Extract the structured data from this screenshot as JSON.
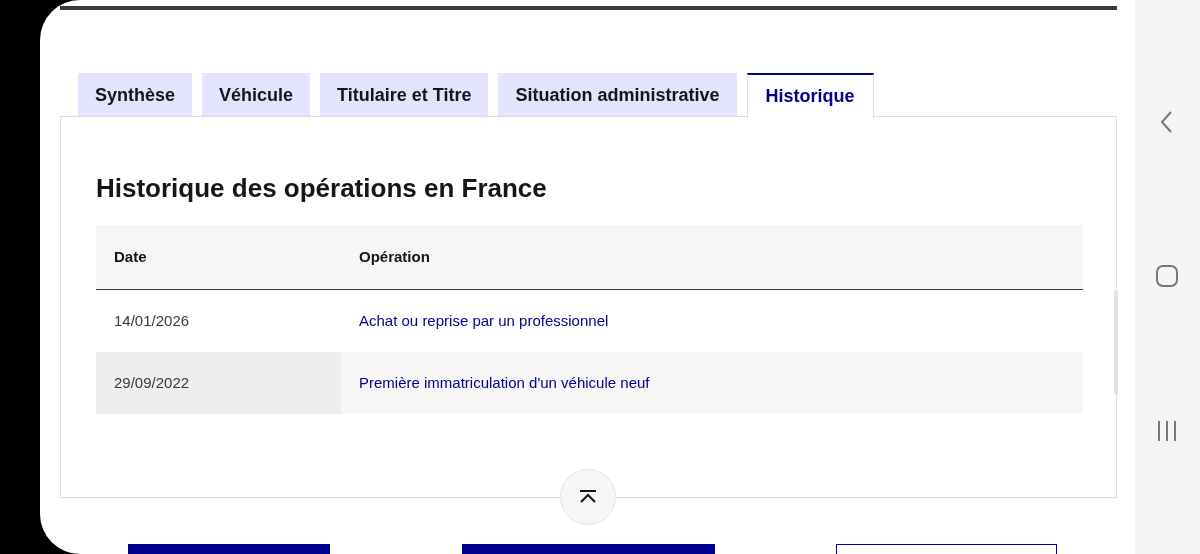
{
  "tabs": [
    {
      "label": "Synthèse",
      "selected": false
    },
    {
      "label": "Véhicule",
      "selected": false
    },
    {
      "label": "Titulaire et Titre",
      "selected": false
    },
    {
      "label": "Situation administrative",
      "selected": false
    },
    {
      "label": "Historique",
      "selected": true
    }
  ],
  "section": {
    "title": "Historique des opérations en France",
    "table": {
      "columns": [
        "Date",
        "Opération"
      ],
      "rows": [
        {
          "date": "14/01/2026",
          "operation": "Achat ou reprise par un professionnel"
        },
        {
          "date": "29/09/2022",
          "operation": "Première immatriculation d'un véhicule neuf"
        }
      ]
    }
  }
}
